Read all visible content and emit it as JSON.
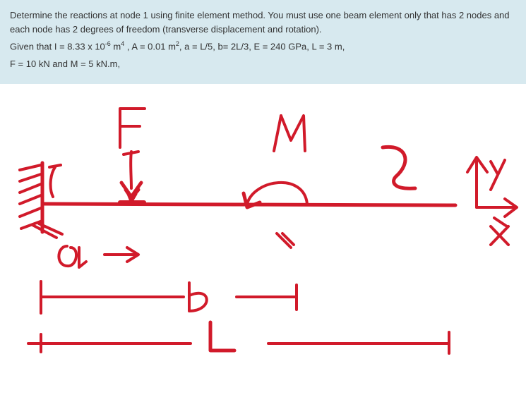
{
  "problem": {
    "line1": "Determine the reactions at node 1 using finite element method. You must use one beam element only that has 2 nodes and each node has 2 degrees of freedom (transverse displacement and rotation).",
    "line2_pre": "Given that I = 8.33 x 10",
    "line2_sup1": "-6",
    "line2_mid": " m",
    "line2_sup2": "4",
    "line2_post1": " , A = 0.01 m",
    "line2_sup3": "2",
    "line2_post2": ", a = L/5, b= 2L/3, E = 240 GPa, L = 3 m,",
    "line3": "F = 10 kN and M = 5 kN.m,"
  },
  "sketch": {
    "F": "F",
    "M": "M",
    "one": "1",
    "two": "2",
    "a": "a",
    "b": "b",
    "L": "L",
    "y": "y",
    "x": "x"
  }
}
